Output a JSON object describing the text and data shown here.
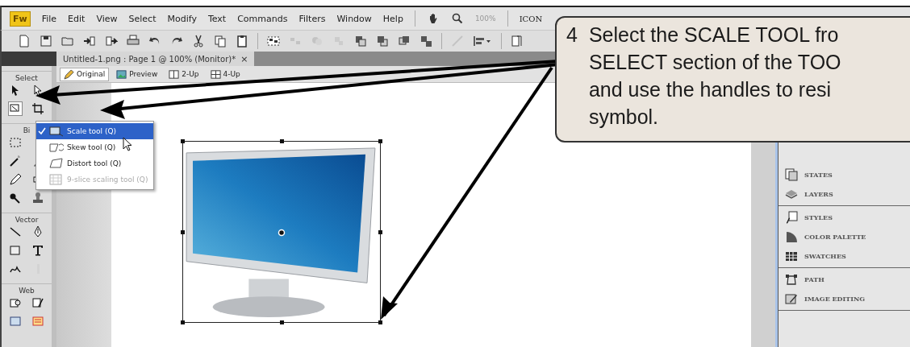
{
  "app_badge": "Fw",
  "menu": [
    "File",
    "Edit",
    "View",
    "Select",
    "Modify",
    "Text",
    "Commands",
    "Filters",
    "Window",
    "Help"
  ],
  "zoom_level": "100%",
  "cut_label": "ICON",
  "document_tab": {
    "title": "Untitled-1.png : Page 1 @ 100% (Monitor)*",
    "close": "×"
  },
  "view_tabs": [
    {
      "label": "Original",
      "kind": "pencil",
      "selected": true
    },
    {
      "label": "Preview",
      "kind": "picture",
      "selected": false
    },
    {
      "label": "2-Up",
      "kind": "split2",
      "selected": false
    },
    {
      "label": "4-Up",
      "kind": "split4",
      "selected": false
    }
  ],
  "tool_sections": [
    {
      "label": "Select"
    },
    {
      "label": "Bi"
    },
    {
      "label": "Vector"
    },
    {
      "label": "Web"
    }
  ],
  "flyout": [
    {
      "label": "Scale tool (Q)",
      "checked": true,
      "selected": true,
      "disabled": false
    },
    {
      "label": "Skew tool (Q)",
      "checked": false,
      "selected": false,
      "disabled": false
    },
    {
      "label": "Distort tool (Q)",
      "checked": false,
      "selected": false,
      "disabled": false
    },
    {
      "label": "9-slice scaling tool (Q)",
      "checked": false,
      "selected": false,
      "disabled": true
    }
  ],
  "panel_groups": [
    {
      "items": [
        {
          "label": "STATES",
          "kind": "states"
        },
        {
          "label": "LAYERS",
          "kind": "layers"
        }
      ]
    },
    {
      "items": [
        {
          "label": "STYLES",
          "kind": "styles"
        },
        {
          "label": "COLOR PALETTE",
          "kind": "palette"
        },
        {
          "label": "SWATCHES",
          "kind": "swatches"
        }
      ]
    },
    {
      "items": [
        {
          "label": "PATH",
          "kind": "path"
        },
        {
          "label": "IMAGE EDITING",
          "kind": "edit"
        }
      ]
    }
  ],
  "callout": {
    "number": "4",
    "lines": [
      "Select the SCALE TOOL fro",
      "SELECT section of the TOO",
      "and use the handles to resi",
      "symbol."
    ]
  }
}
